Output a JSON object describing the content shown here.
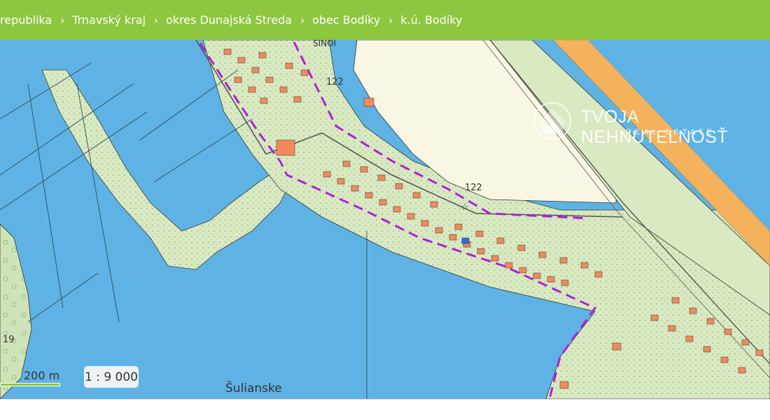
{
  "breadcrumb": {
    "items": [
      "republika",
      "Trnavský kraj",
      "okres Dunajská Streda",
      "obec Bodíky",
      "k.ú. Bodíky"
    ],
    "separator": "›"
  },
  "map": {
    "labels": {
      "elevation_top": "122",
      "elevation_mid": "122",
      "parcel_left": "19",
      "lake_name": "Šulianske",
      "street_fragment": "SINOI"
    }
  },
  "scale": {
    "label": "200 m",
    "ratio": "1 : 9 000"
  },
  "watermark": {
    "title": "TVOJA NEHNUTEĽNOSŤ",
    "subtitle": "REAL ESTATE"
  },
  "colors": {
    "header_green": "#8dc63f",
    "water": "#5fb3e4",
    "land_green": "#d9e9c2",
    "field": "#faf6e4",
    "road_orange": "#f5b25d",
    "boundary_purple": "#b01fd6",
    "building": "#f08a5d"
  }
}
